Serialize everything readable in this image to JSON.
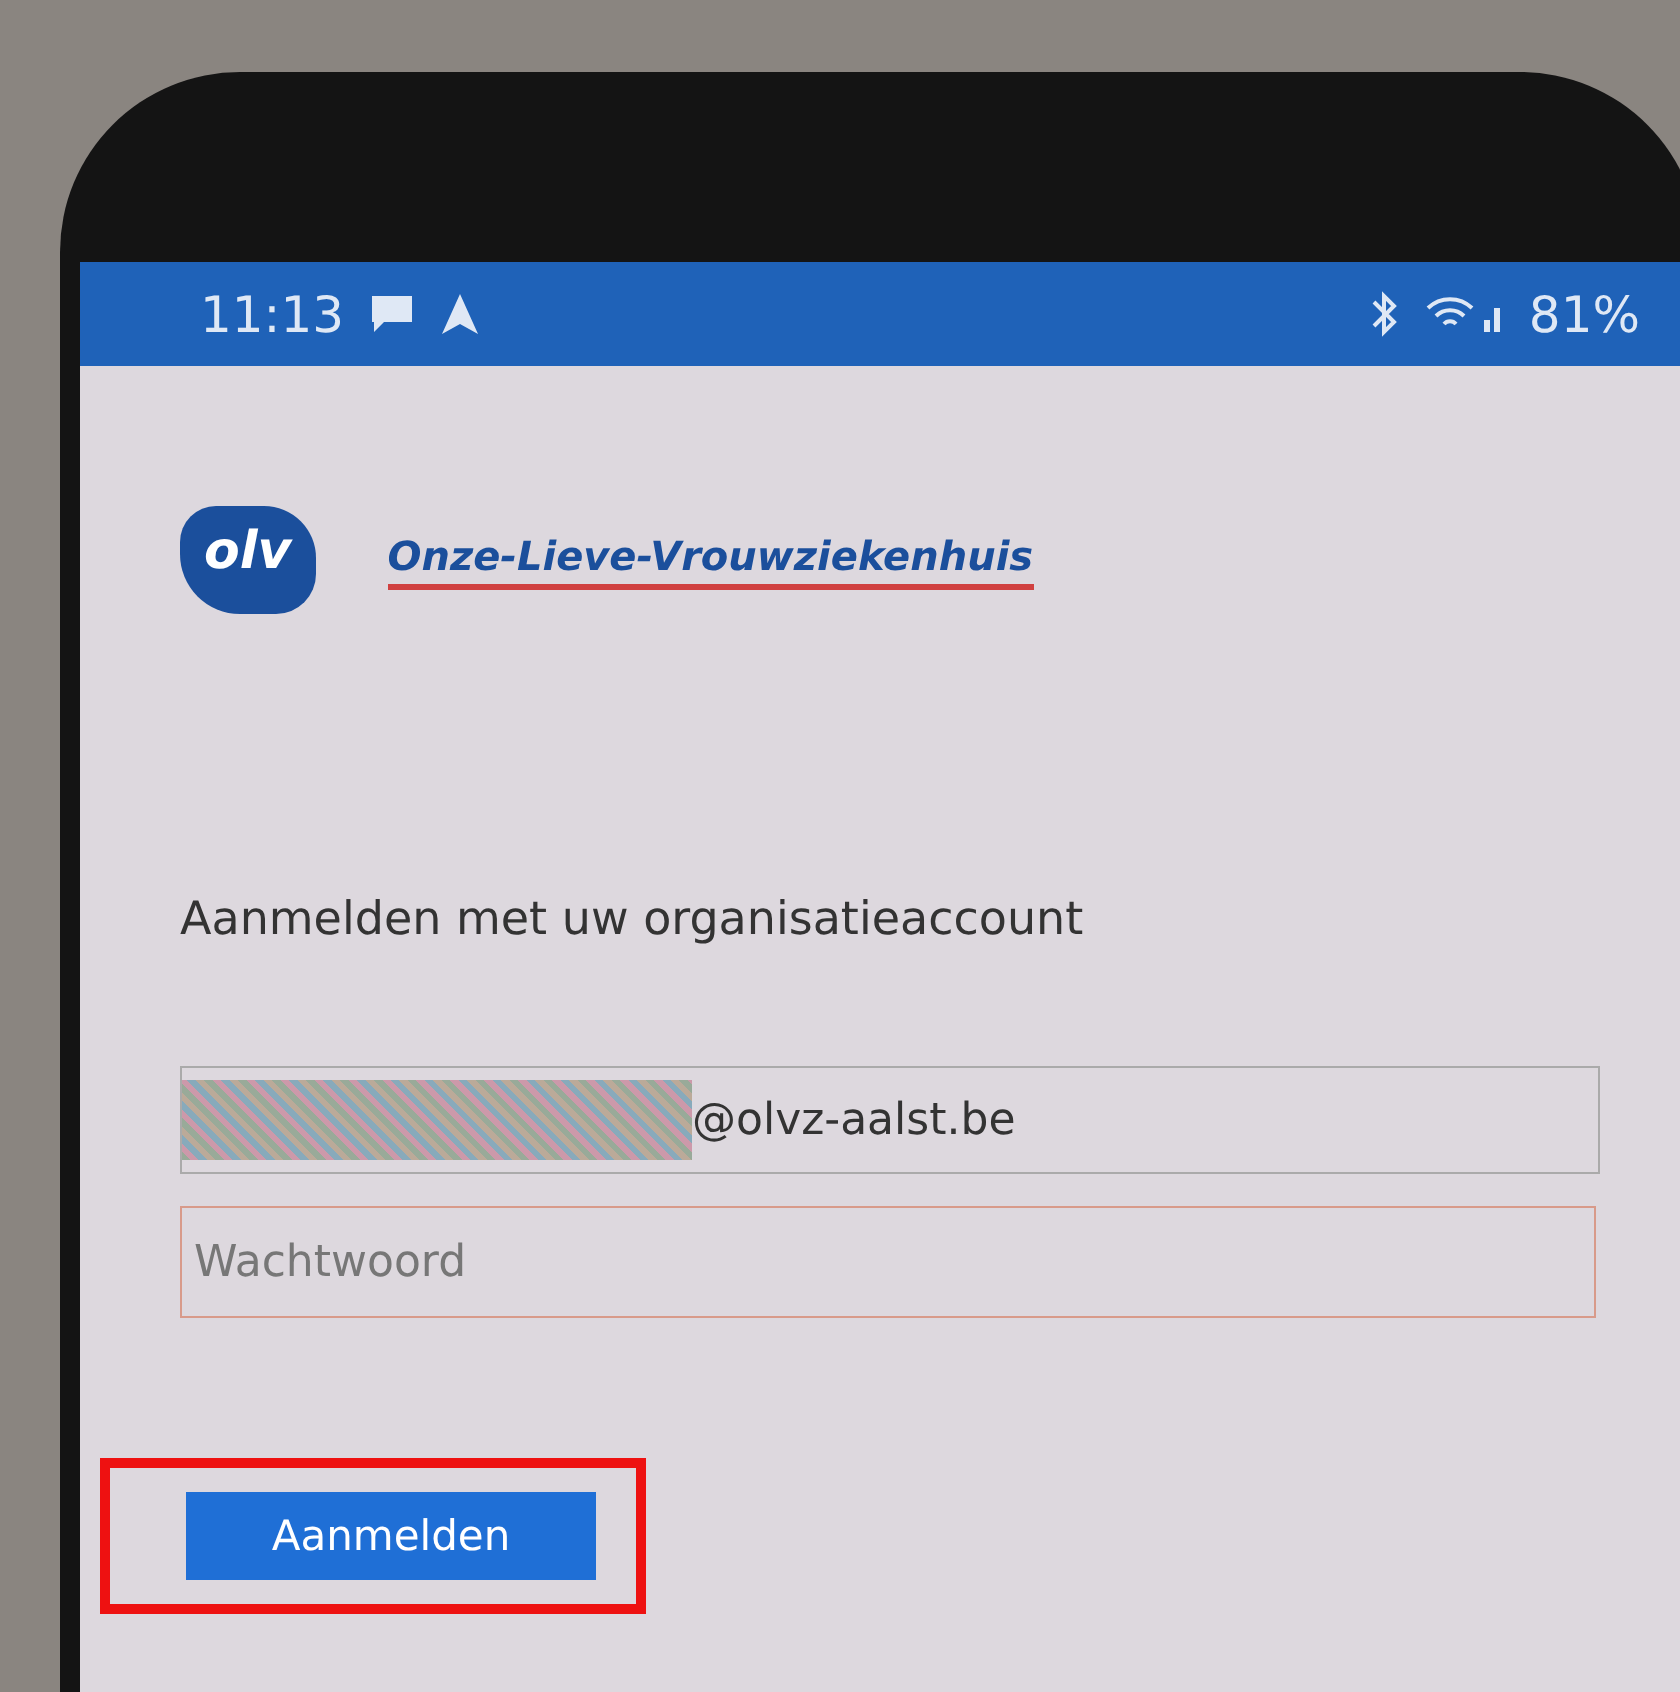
{
  "status_bar": {
    "time": "11:13",
    "battery": "81%"
  },
  "header": {
    "logo_mark": "olv",
    "organization": "Onze-Lieve-Vrouwziekenhuis"
  },
  "heading": "Aanmelden met uw organisatieaccount",
  "email_field": {
    "value": "@olvz-aalst.be",
    "redacted": true
  },
  "password_field": {
    "placeholder": "Wachtwoord"
  },
  "sign_in_button": {
    "label": "Aanmelden",
    "highlighted": true
  }
}
